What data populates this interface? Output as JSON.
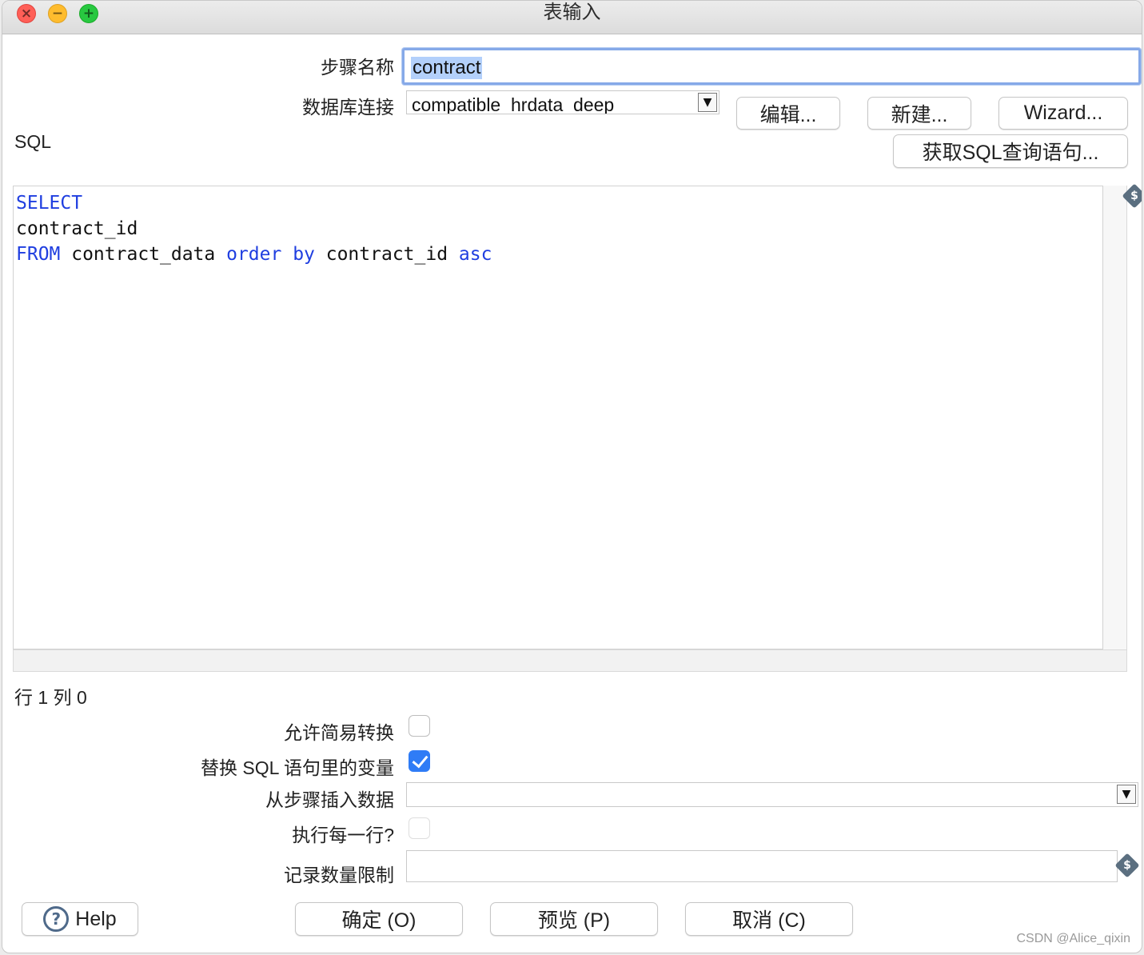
{
  "window": {
    "title": "表输入"
  },
  "form": {
    "step_name_label": "步骤名称",
    "step_name_value": "contract",
    "db_connection_label": "数据库连接",
    "db_connection_value": "compatible_hrdata_deep",
    "edit_button": "编辑...",
    "new_button": "新建...",
    "wizard_button": "Wizard...",
    "sql_label": "SQL",
    "get_sql_button": "获取SQL查询语句..."
  },
  "sql": {
    "line1_kw": "SELECT",
    "line2": "contract_id",
    "line3_kw1": "FROM",
    "line3_t1": " contract_data ",
    "line3_kw2": "order by",
    "line3_t2": " contract_id ",
    "line3_kw3": "asc"
  },
  "status": {
    "cursor_position": "行 1 列 0"
  },
  "options": {
    "lazy_conversion_label": "允许简易转换",
    "lazy_conversion_checked": false,
    "replace_vars_label": "替换 SQL 语句里的变量",
    "replace_vars_checked": true,
    "insert_from_step_label": "从步骤插入数据",
    "insert_from_step_value": "",
    "execute_each_row_label": "执行每一行?",
    "execute_each_row_checked": false,
    "limit_label": "记录数量限制",
    "limit_value": ""
  },
  "footer": {
    "help_button": "Help",
    "ok_button": "确定 (O)",
    "preview_button": "预览 (P)",
    "cancel_button": "取消 (C)",
    "watermark": "CSDN @Alice_qixin"
  },
  "icons": {
    "variable_icon": "$"
  },
  "colors": {
    "keyword": "#1f3ee0",
    "checkbox_checked": "#2f7cf6",
    "focus_ring": "#86a9e8"
  }
}
